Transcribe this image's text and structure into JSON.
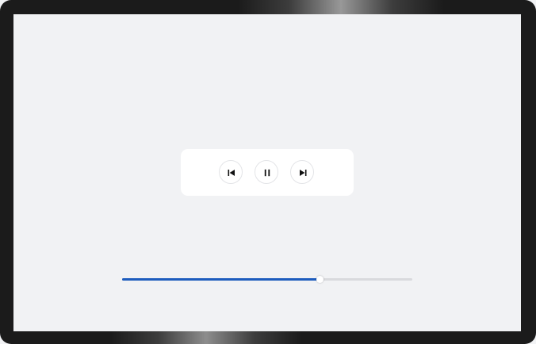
{
  "player": {
    "controls": {
      "previous_icon": "skip-previous-icon",
      "pause_icon": "pause-icon",
      "next_icon": "skip-next-icon"
    },
    "progress": {
      "fraction": 0.68
    },
    "colors": {
      "accent": "#1d5cbd",
      "track": "#d9dadd",
      "screen_background": "#f1f2f4",
      "bezel": "#1b1b1b",
      "card": "#ffffff"
    }
  }
}
